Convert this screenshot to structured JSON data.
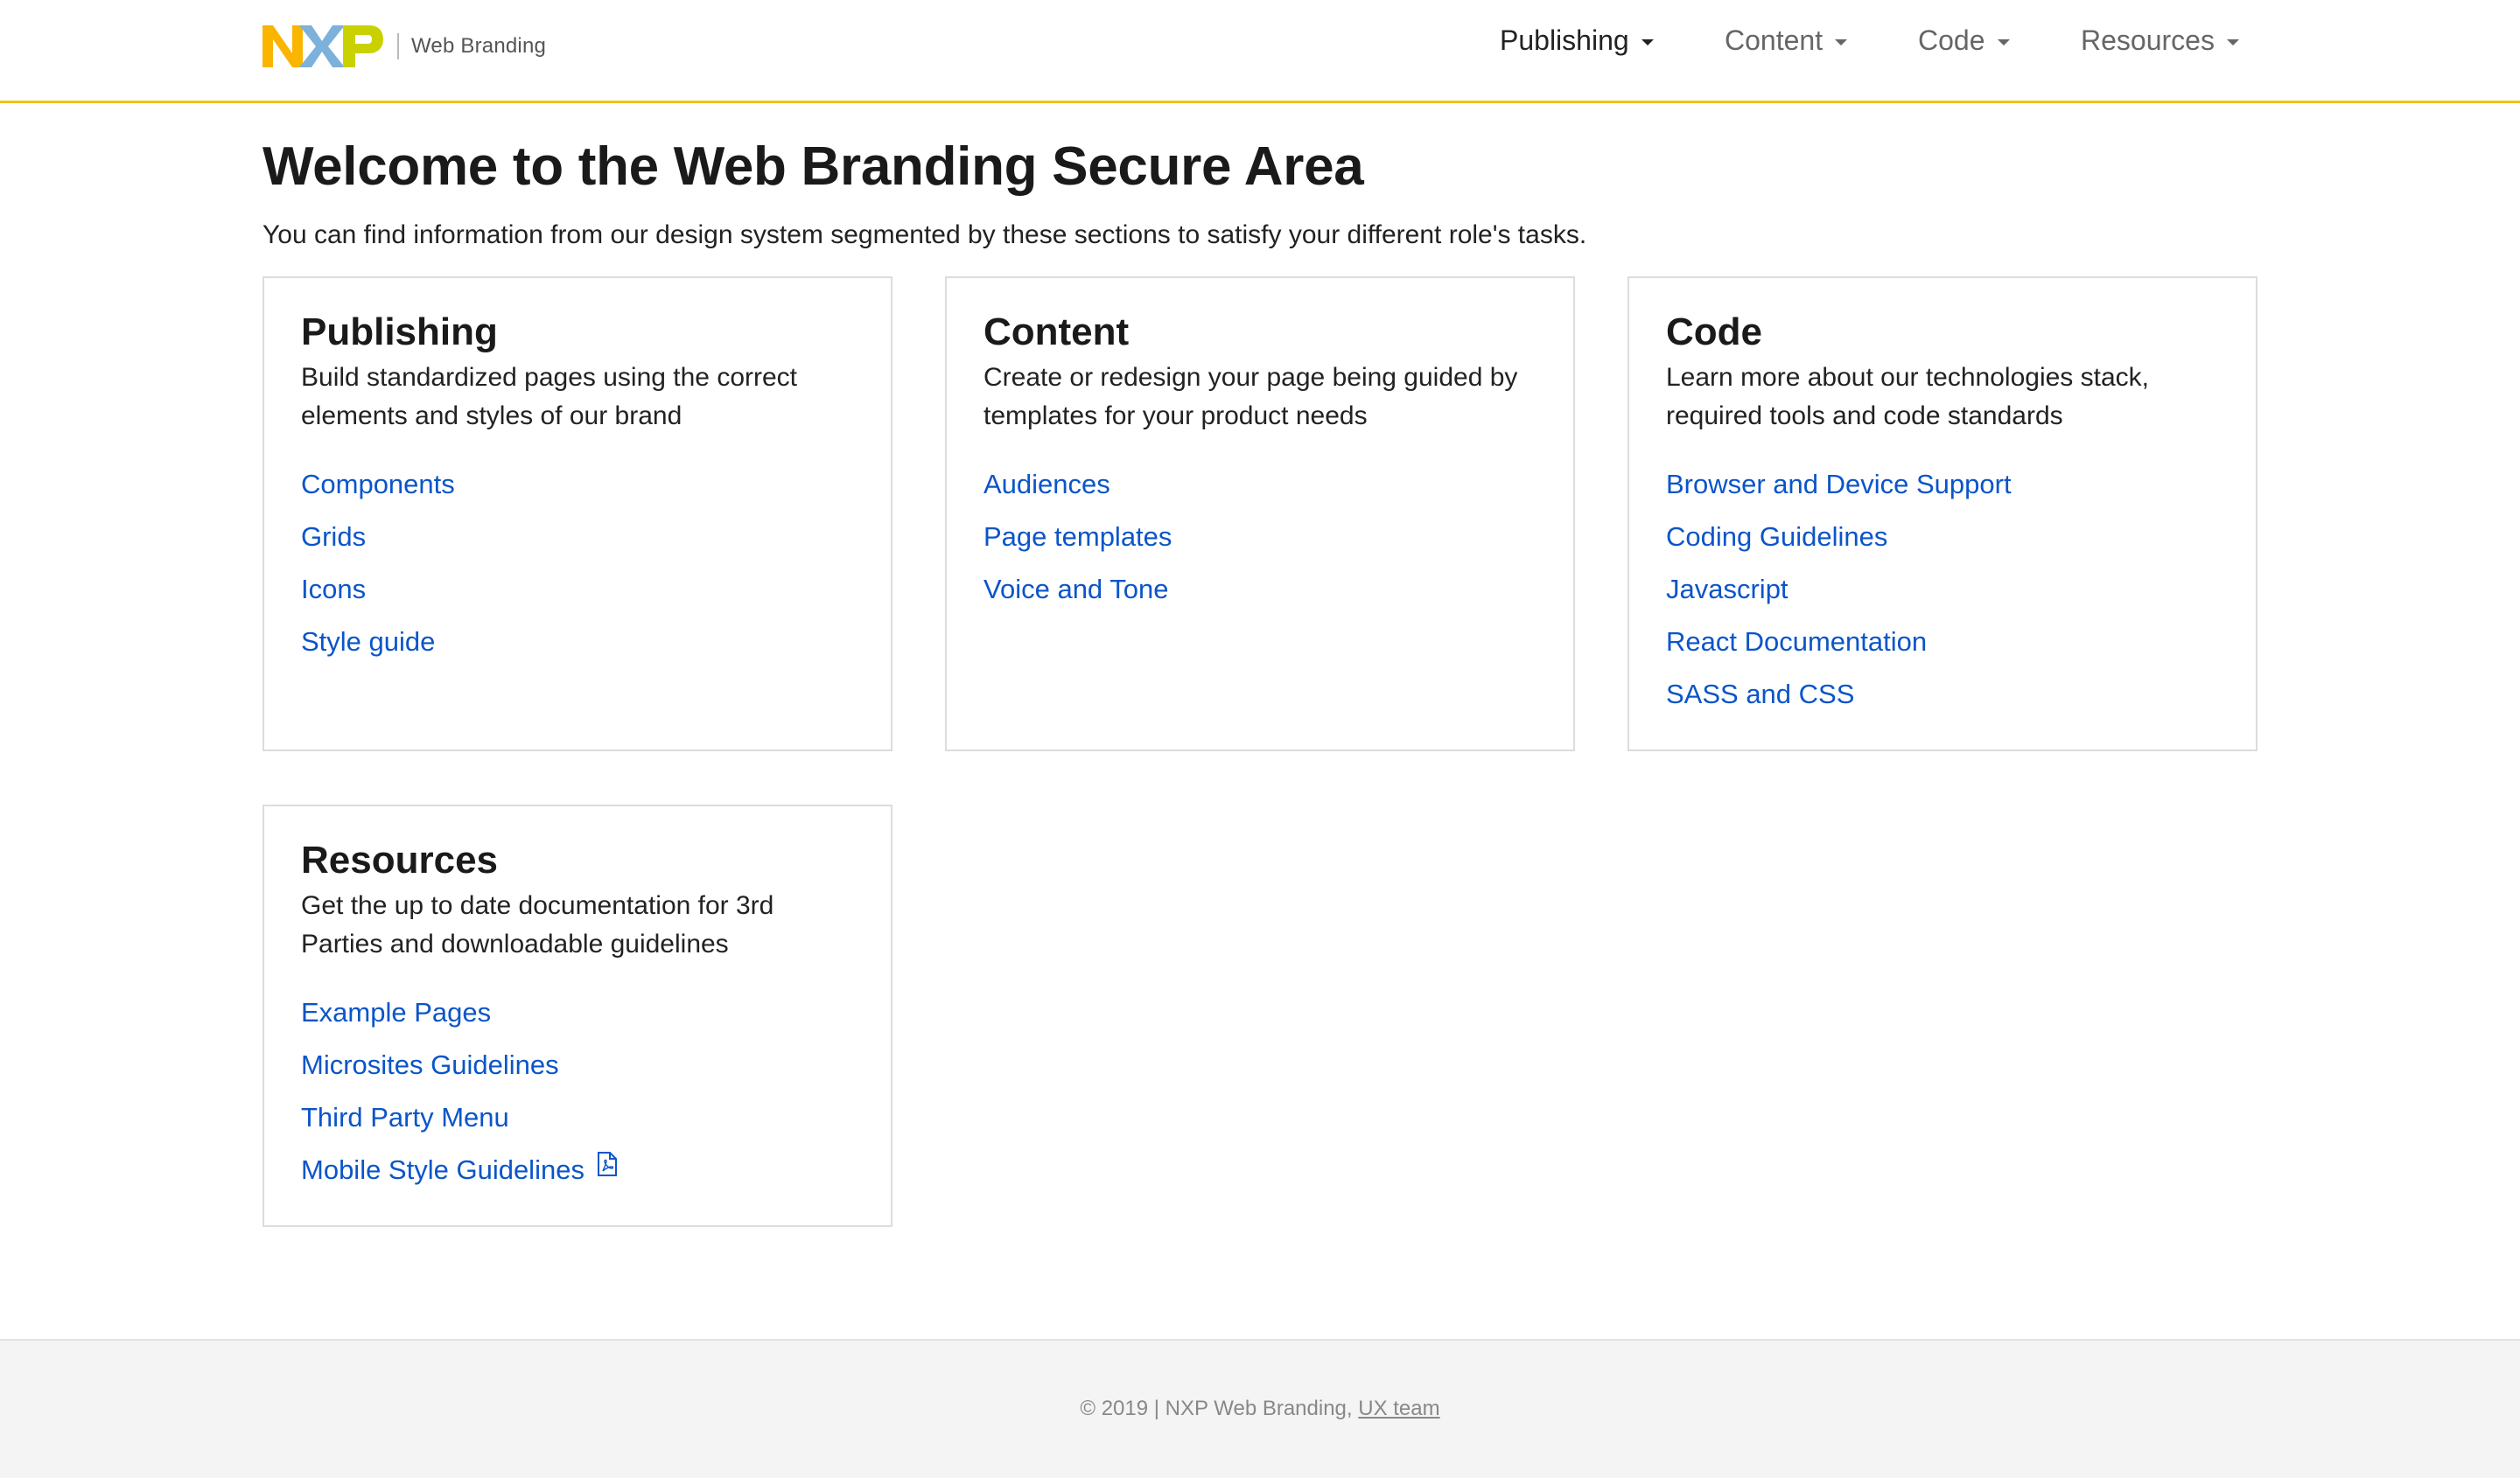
{
  "header": {
    "brand_label": "Web Branding",
    "logo_text": "NXP",
    "nav": [
      {
        "label": "Publishing",
        "active": true
      },
      {
        "label": "Content",
        "active": false
      },
      {
        "label": "Code",
        "active": false
      },
      {
        "label": "Resources",
        "active": false
      }
    ]
  },
  "main": {
    "title": "Welcome to the Web Branding Secure Area",
    "intro": "You can find information from our design system segmented by these sections to satisfy your different role's tasks.",
    "cards": [
      {
        "title": "Publishing",
        "description": "Build standardized pages using the correct elements and styles of our brand",
        "links": [
          "Components",
          "Grids",
          "Icons",
          "Style guide"
        ]
      },
      {
        "title": "Content",
        "description": "Create or redesign your page being guided by templates for your product needs",
        "links": [
          "Audiences",
          "Page templates",
          "Voice and Tone"
        ]
      },
      {
        "title": "Code",
        "description": "Learn more about our technologies stack, required tools and code standards",
        "links": [
          "Browser and Device Support",
          "Coding Guidelines",
          "Javascript",
          "React Documentation",
          "SASS and CSS"
        ]
      },
      {
        "title": "Resources",
        "description": "Get the up to date documentation for 3rd Parties and downloadable guidelines",
        "links": [
          "Example Pages",
          "Microsites Guidelines",
          "Third Party Menu",
          "Mobile Style Guidelines"
        ],
        "pdf_link_icon": "pdf-file-icon"
      }
    ]
  },
  "footer": {
    "text": "© 2019 | NXP Web Branding, ",
    "link": "UX team"
  },
  "colors": {
    "accent_line": "#f1c21b",
    "link": "#0a55c9",
    "logo_n": "#f9b500",
    "logo_x": "#7bb1db",
    "logo_p": "#c9d200"
  }
}
